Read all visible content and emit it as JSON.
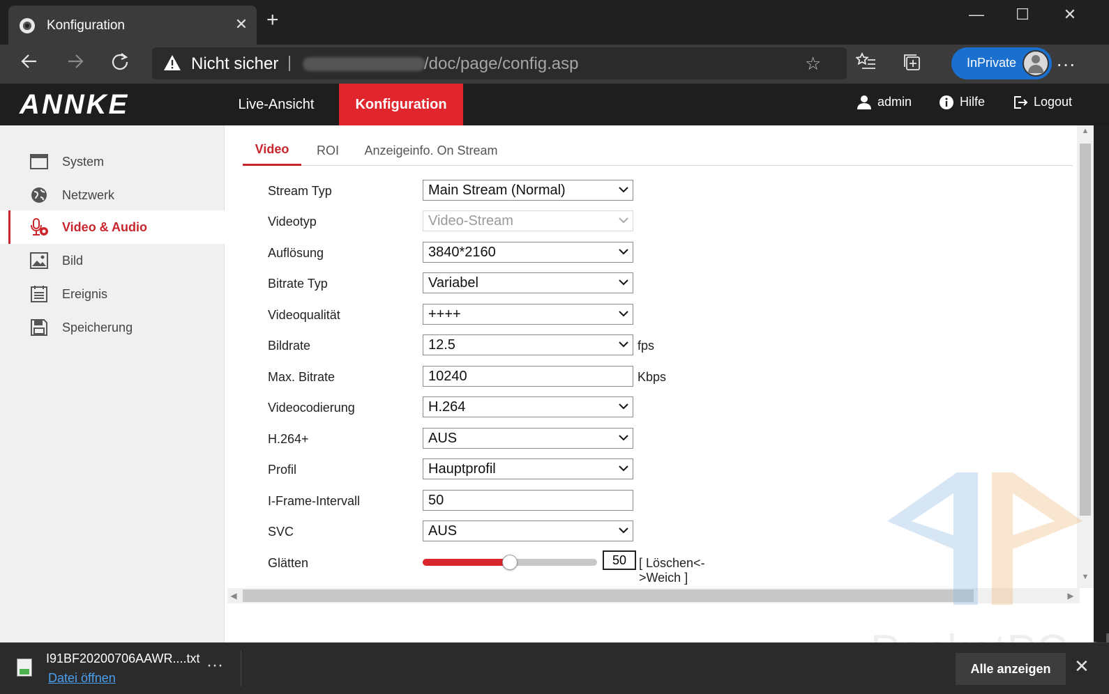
{
  "browser": {
    "tab_title": "Konfiguration",
    "tab_close": "✕",
    "new_tab": "+",
    "window": {
      "minimize": "—",
      "maximize": "☐",
      "close": "✕"
    },
    "security_label": "Nicht sicher",
    "url_path": "/doc/page/config.asp",
    "inprivate_label": "InPrivate",
    "more": "···"
  },
  "app": {
    "logo": "ANNKE",
    "nav": [
      {
        "label": "Live-Ansicht",
        "active": false
      },
      {
        "label": "Konfiguration",
        "active": true
      }
    ],
    "header_links": {
      "user": "admin",
      "help": "Hilfe",
      "logout": "Logout"
    },
    "accent_color": "#e0252c"
  },
  "sidebar": {
    "items": [
      {
        "label": "System",
        "icon": "monitor-icon",
        "active": false
      },
      {
        "label": "Netzwerk",
        "icon": "globe-icon",
        "active": false
      },
      {
        "label": "Video & Audio",
        "icon": "microphone-icon",
        "active": true
      },
      {
        "label": "Bild",
        "icon": "image-icon",
        "active": false
      },
      {
        "label": "Ereignis",
        "icon": "calendar-icon",
        "active": false
      },
      {
        "label": "Speicherung",
        "icon": "floppy-icon",
        "active": false
      }
    ]
  },
  "content": {
    "tabs": [
      {
        "label": "Video",
        "active": true
      },
      {
        "label": "ROI",
        "active": false
      },
      {
        "label": "Anzeigeinfo. On Stream",
        "active": false
      }
    ],
    "form": {
      "stream_typ": {
        "label": "Stream Typ",
        "value": "Main Stream (Normal)"
      },
      "videotyp": {
        "label": "Videotyp",
        "value": "Video-Stream"
      },
      "aufloesung": {
        "label": "Auflösung",
        "value": "3840*2160"
      },
      "bitrate_typ": {
        "label": "Bitrate Typ",
        "value": "Variabel"
      },
      "videoqualitaet": {
        "label": "Videoqualität",
        "value": "++++"
      },
      "bildrate": {
        "label": "Bildrate",
        "value": "12.5",
        "unit": "fps"
      },
      "max_bitrate": {
        "label": "Max. Bitrate",
        "value": "10240",
        "unit": "Kbps"
      },
      "videocodierung": {
        "label": "Videocodierung",
        "value": "H.264"
      },
      "h264plus": {
        "label": "H.264+",
        "value": "AUS"
      },
      "profil": {
        "label": "Profil",
        "value": "Hauptprofil"
      },
      "iframe": {
        "label": "I-Frame-Intervall",
        "value": "50"
      },
      "svc": {
        "label": "SVC",
        "value": "AUS"
      },
      "glaetten": {
        "label": "Glätten",
        "value": "50",
        "level_fraction": 0.5,
        "hint": "[ Löschen<->Weich ]"
      }
    }
  },
  "watermark_text": "PocketPC.ch",
  "download": {
    "filename": "I91BF20200706AAWR....txt",
    "open_label": "Datei öffnen",
    "more": "···",
    "show_all": "Alle anzeigen",
    "close": "✕"
  }
}
